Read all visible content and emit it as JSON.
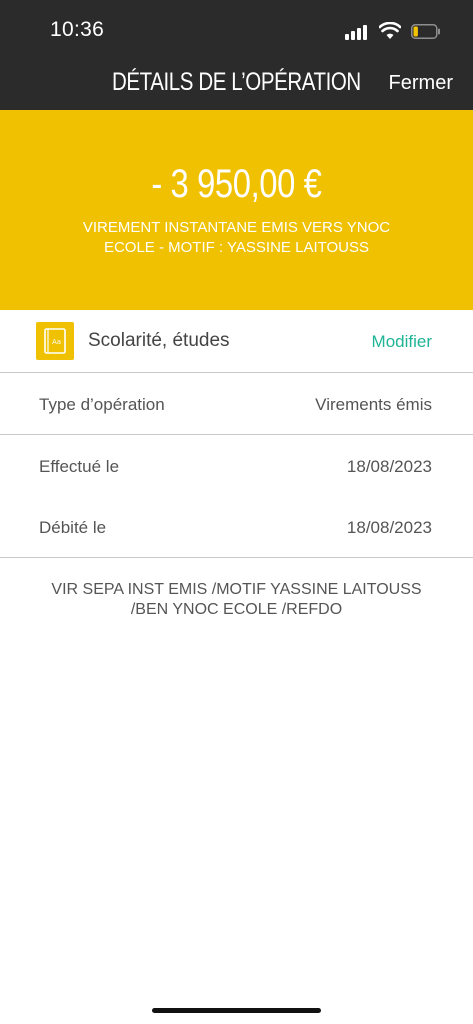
{
  "status_bar": {
    "time": "10:36",
    "battery_level": 0.2,
    "battery_color": "#f4c300"
  },
  "header": {
    "title": "DÉTAILS DE L’OPÉRATION",
    "close_label": "Fermer",
    "background": "#2b2b2b"
  },
  "operation": {
    "amount": "- 3 950,00 €",
    "description": "VIREMENT INSTANTANE EMIS VERS YNOC ECOLE - MOTIF : YASSINE LAITOUSS",
    "accent": "#efc100"
  },
  "category": {
    "icon": "book-icon",
    "label": "Scolarité, études",
    "modify_label": "Modifier",
    "modify_color": "#1fb496"
  },
  "details": [
    {
      "key": "Type d’opération",
      "value": "Virements émis"
    },
    {
      "key": "Effectué le",
      "value": "18/08/2023"
    },
    {
      "key": "Débité le",
      "value": "18/08/2023"
    }
  ],
  "note": "VIR SEPA INST EMIS /MOTIF YASSINE LAITOUSS /BEN YNOC ECOLE /REFDO"
}
